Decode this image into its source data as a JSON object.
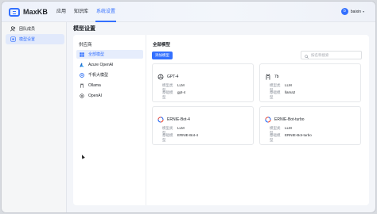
{
  "app": {
    "name": "MaxKB"
  },
  "nav": {
    "items": [
      "应用",
      "知识库",
      "系统设置"
    ],
    "active_index": 2
  },
  "user": {
    "avatar_letter": "b",
    "name": "baixin"
  },
  "sidebar": {
    "items": [
      {
        "label": "团队成员",
        "icon": "team-icon"
      },
      {
        "label": "模型设置",
        "icon": "model-icon",
        "active": true
      }
    ]
  },
  "main": {
    "title": "模型设置",
    "provider_header": "供应商",
    "providers": [
      {
        "label": "全部模型",
        "icon": "grid-icon",
        "active": true
      },
      {
        "label": "Azure OpenAI",
        "icon": "azure-icon"
      },
      {
        "label": "千帆大模型",
        "icon": "qianfan-icon"
      },
      {
        "label": "Ollama",
        "icon": "ollama-icon"
      },
      {
        "label": "OpenAI",
        "icon": "openai-icon"
      }
    ],
    "models_header": "全部模型",
    "add_button": "添加模型",
    "search_placeholder": "按名称搜索",
    "type_label": "模型类型",
    "base_label": "基础模型",
    "cards": [
      {
        "name": "GPT-4",
        "icon": "openai-icon",
        "type": "LLM",
        "base": "gpt-4"
      },
      {
        "name": "7b",
        "icon": "ollama-icon",
        "type": "LLM",
        "base": "llama2"
      },
      {
        "name": "ERNIE-Bot-4",
        "icon": "qianfan-icon",
        "type": "LLM",
        "base": "ERNIE-Bot-4"
      },
      {
        "name": "ERNIE-Bot-turbo",
        "icon": "qianfan-icon",
        "type": "LLM",
        "base": "ERNIE-Bot-turbo"
      }
    ]
  },
  "colors": {
    "accent": "#3370ff",
    "text": "#1f2329",
    "muted": "#8f959e"
  }
}
